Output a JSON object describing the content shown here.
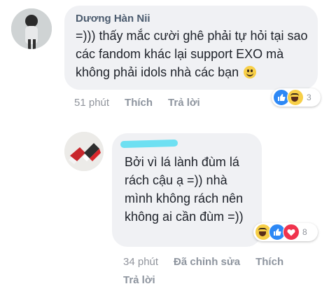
{
  "comments": [
    {
      "author": "Dương Hàn Nii",
      "text": "=))) thấy mắc cười ghê phải tự hỏi tại sao các fandom khác lại support EXO mà không phải idols nhà các bạn",
      "time": "51 phút",
      "like_action": "Thích",
      "reply_action": "Trả lời",
      "reaction_count": "3",
      "reactions": [
        "like",
        "haha"
      ]
    },
    {
      "author": "",
      "text": "Bởi vì lá lành đùm lá rách cậu ạ =)) nhà mình không rách nên không ai cần đùm =))",
      "time": "34 phút",
      "edited_label": "Đã chỉnh sửa",
      "like_action": "Thích",
      "reply_action": "Trả lời",
      "reaction_count": "8",
      "reactions": [
        "haha",
        "like",
        "love"
      ]
    }
  ],
  "colors": {
    "bubble": "#f0f1f4",
    "like": "#2d88f5",
    "haha": "#f7cf48",
    "love": "#f0334d",
    "meta": "#90949c",
    "author": "#4b5b6e"
  }
}
